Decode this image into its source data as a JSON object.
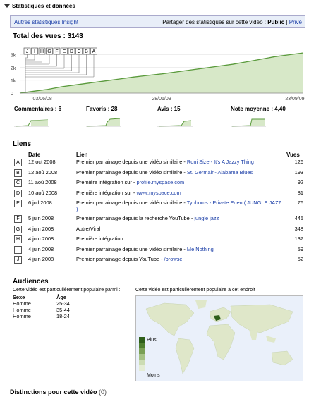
{
  "header": {
    "title": "Statistiques et données"
  },
  "toolbar": {
    "insight_link": "Autres statistiques Insight",
    "share_text": "Partager des statistiques sur cette vidéo : ",
    "public": "Public",
    "separator": "|",
    "private": "Privé"
  },
  "views": {
    "title": "Total des vues : 3143"
  },
  "chart_data": {
    "type": "area",
    "title": "Total des vues : 3143",
    "x_ticks": [
      "03/06/08",
      "28/01/09",
      "23/09/09"
    ],
    "y_ticks": [
      "3k",
      "2k",
      "1k",
      "0"
    ],
    "ylim": [
      0,
      3200
    ],
    "x": [
      0,
      0.05,
      0.1,
      0.15,
      0.2,
      0.25,
      0.3,
      0.35,
      0.4,
      0.45,
      0.5,
      0.55,
      0.6,
      0.65,
      0.7,
      0.75,
      0.8,
      0.85,
      0.9,
      0.95,
      1.0
    ],
    "values": [
      0,
      150,
      300,
      500,
      650,
      800,
      950,
      1100,
      1250,
      1380,
      1500,
      1650,
      1800,
      1950,
      2100,
      2250,
      2450,
      2650,
      2850,
      3000,
      3143
    ],
    "markers": [
      "J",
      "I",
      "H",
      "G",
      "F",
      "E",
      "D",
      "C",
      "B",
      "A"
    ],
    "color": "#5a9a3c",
    "fill": "#d7e8c8"
  },
  "stats": [
    {
      "label": "Commentaires : 6"
    },
    {
      "label": "Favoris : 28"
    },
    {
      "label": "Avis : 15"
    },
    {
      "label": "Note moyenne : 4,40"
    }
  ],
  "links": {
    "title": "Liens",
    "headers": {
      "date": "Date",
      "link": "Lien",
      "views": "Vues"
    },
    "rows": [
      {
        "letter": "A",
        "date": "12 oct 2008",
        "text": "Premier parrainage depuis une vidéo similaire - ",
        "link": "Roni Size - It's A Jazzy Thing",
        "views": "126"
      },
      {
        "letter": "B",
        "date": "12 aoû 2008",
        "text": "Premier parrainage depuis une vidéo similaire - ",
        "link": "St. Germain- Alabama Blues",
        "views": "193"
      },
      {
        "letter": "C",
        "date": "11 aoû 2008",
        "text": "Première intégration sur - ",
        "link": "profile.myspace.com",
        "views": "92"
      },
      {
        "letter": "D",
        "date": "10 aoû 2008",
        "text": "Première intégration sur - ",
        "link": "www.myspace.com",
        "views": "81"
      },
      {
        "letter": "E",
        "date": "6 juil 2008",
        "text": "Premier parrainage depuis une vidéo similaire - ",
        "link": "Typhoms - Private Eden ( JUNGLE JAZZ )",
        "views": "76"
      },
      {
        "letter": "F",
        "date": "5 juin 2008",
        "text": "Premier parrainage depuis la recherche YouTube - ",
        "link": "jungle jazz",
        "views": "445"
      },
      {
        "letter": "G",
        "date": "4 juin 2008",
        "text": "Autre/Viral",
        "link": "",
        "views": "348"
      },
      {
        "letter": "H",
        "date": "4 juin 2008",
        "text": "Première intégration",
        "link": "",
        "views": "137"
      },
      {
        "letter": "I",
        "date": "4 juin 2008",
        "text": "Premier parrainage depuis une vidéo similaire - ",
        "link": "Me Nothing",
        "views": "59"
      },
      {
        "letter": "J",
        "date": "4 juin 2008",
        "text": "Premier parrainage depuis YouTube - ",
        "link": "/browse",
        "views": "52"
      }
    ]
  },
  "audiences": {
    "title": "Audiences",
    "popular_among": "Cette vidéo est particulièrement populaire parmi :",
    "popular_at": "Cette vidéo est particulièrement populaire à cet endroit :",
    "headers": {
      "sex": "Sexe",
      "age": "Âge"
    },
    "rows": [
      {
        "sex": "Homme",
        "age": "25-34"
      },
      {
        "sex": "Homme",
        "age": "35-44"
      },
      {
        "sex": "Homme",
        "age": "18-24"
      }
    ],
    "legend_more": "Plus",
    "legend_less": "Moins"
  },
  "distinctions": {
    "title": "Distinctions pour cette vidéo",
    "count": "(0)"
  }
}
